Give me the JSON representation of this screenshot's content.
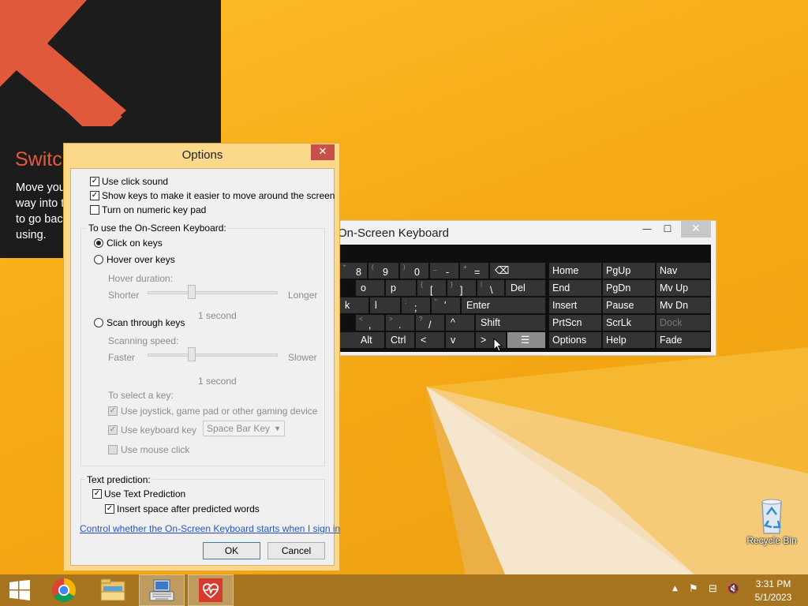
{
  "tutorial": {
    "title": "Switch",
    "lines": [
      "Move you",
      "way into t",
      "to go bac",
      "using."
    ]
  },
  "options_dialog": {
    "title": "Options",
    "close_glyph": "✕",
    "use_click_sound": "Use click sound",
    "show_keys": "Show keys to make it easier to move around the screen",
    "numeric_keypad": "Turn on numeric key pad",
    "group_label": "To use the On-Screen Keyboard:",
    "click_on_keys": "Click on keys",
    "hover_over_keys": "Hover over keys",
    "hover_duration": "Hover duration:",
    "shorter": "Shorter",
    "longer": "Longer",
    "hover_value": "1 second",
    "scan_through_keys": "Scan through keys",
    "scanning_speed": "Scanning speed:",
    "faster": "Faster",
    "slower": "Slower",
    "scan_value": "1 second",
    "to_select_key": "To select a key:",
    "use_joystick": "Use joystick, game pad or other gaming device",
    "use_keyboard_key": "Use keyboard key",
    "keyboard_key_value": "Space Bar Key",
    "use_mouse_click": "Use mouse click",
    "text_prediction_label": "Text prediction:",
    "use_text_prediction": "Use Text Prediction",
    "insert_space": "Insert space after predicted words",
    "link": "Control whether the On-Screen Keyboard starts when I sign in",
    "ok": "OK",
    "cancel": "Cancel"
  },
  "osk": {
    "title": "On-Screen Keyboard",
    "minimize_glyph": "—",
    "maximize_glyph": "☐",
    "close_glyph": "✕",
    "keys": {
      "k8": "8",
      "k9": "9",
      "k0": "0",
      "kminus": "-",
      "kequal": "=",
      "s8": "*",
      "s9": "(",
      "s0": ")",
      "sminus": "_",
      "sequal": "+",
      "ko": "o",
      "kp": "p",
      "klb": "[",
      "krb": "]",
      "kbs": "\\",
      "del": "Del",
      "slb": "{",
      "srb": "}",
      "sbs": "|",
      "kk": "k",
      "kl": "l",
      "ksemi": ";",
      "kquote": "'",
      "enter": "Enter",
      "ssemi": ":",
      "squote": "\"",
      "kcomma": ",",
      "kperiod": ".",
      "kslash": "/",
      "up": "^",
      "shift": "Shift",
      "scomma": "<",
      "speriod": ">",
      "sslash": "?",
      "alt": "Alt",
      "ctrl": "Ctrl",
      "left": "<",
      "down": "v",
      "right": ">",
      "home": "Home",
      "pgup": "PgUp",
      "nav": "Nav",
      "end": "End",
      "pgdn": "PgDn",
      "mvup": "Mv Up",
      "insert": "Insert",
      "pause": "Pause",
      "mvdn": "Mv Dn",
      "prtscn": "PrtScn",
      "scrlk": "ScrLk",
      "dock": "Dock",
      "options": "Options",
      "help": "Help",
      "fade": "Fade"
    }
  },
  "desktop": {
    "recycle_bin": "Recycle Bin"
  },
  "taskbar": {
    "time": "3:31 PM",
    "date": "5/1/2023"
  },
  "colors": {
    "accent_orange": "#e8593b",
    "desktop_yellow": "#f6aa13",
    "taskbar": "#a77520"
  }
}
